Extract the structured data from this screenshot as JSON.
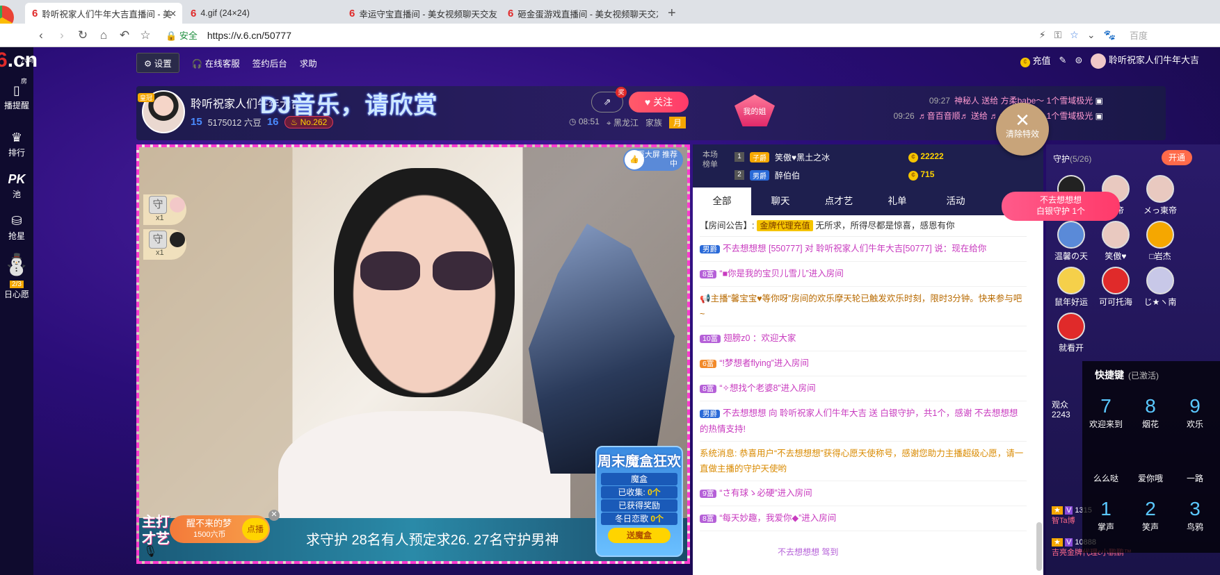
{
  "browser": {
    "tabs": [
      {
        "label": "聆听祝家人们牛年大吉直播间 - 美",
        "active": true
      },
      {
        "label": "4.gif (24×24)",
        "active": false
      },
      {
        "label": "幸运守宝直播间 - 美女视频聊天交友",
        "active": false
      },
      {
        "label": "砸金蛋游戏直播间 - 美女视频聊天交友",
        "active": false
      }
    ],
    "secure": "安全",
    "url": "https://v.6.cn/50777",
    "search_engine": "百度"
  },
  "site": {
    "logo": "6.cn",
    "logo_sub": "六间房",
    "left_nav": [
      "播提醒",
      "排行",
      "池",
      "抢星",
      "日心愿"
    ],
    "pk": "PK",
    "wish_count": "2/3",
    "menu": {
      "settings": "设置",
      "service": "在线客服",
      "checkin": "签约后台",
      "help": "求助"
    },
    "top_right": {
      "recharge": "充值",
      "user": "聆听祝家人们牛年大吉"
    }
  },
  "host": {
    "vip": "皇冠",
    "name": "聆听祝家人们牛年大吉",
    "banner": "DJ音乐，请欣赏",
    "level": "15",
    "beans": "5175012 六豆",
    "wealth": "16",
    "rank": "No.262",
    "follow": "关注",
    "share_tag": "奖",
    "time": "08:51",
    "location": "黑龙江",
    "family": "家族",
    "family_badge": "月",
    "my_dear": "我的姐"
  },
  "gift_feed": [
    {
      "time": "09:27",
      "text": "神秘人 送给 方柔babe～ 1个雪域极光"
    },
    {
      "time": "09:26",
      "text": "♬音百音顺♬ 送给 ♬♪百音百顺♬ 1个雪域极光"
    }
  ],
  "clear_fx": "清除特效",
  "video": {
    "featured": "首页大屏 推荐中",
    "guard_counts": [
      "x1",
      "x1"
    ],
    "main_play": "主打 才艺",
    "wake": {
      "title": "醒不来的梦",
      "price": "1500六币",
      "btn": "点播"
    },
    "marquee": "求守护  28名有人预定求26. 27名守护男神",
    "box": {
      "title": "周末魔盒狂欢",
      "sub": "魔盒",
      "collected_label": "已收集:",
      "collected": "0个",
      "reward": "已获得奖励",
      "winter": "冬日恋歌",
      "winter_count": "0个",
      "btn": "送魔盒"
    }
  },
  "rankboard": {
    "label": "本场 榜单",
    "rows": [
      {
        "n": "1",
        "badge": "子爵",
        "name": "笑傲♥黑土之冰",
        "amt": "22222"
      },
      {
        "n": "2",
        "badge": "男爵",
        "name": "醉伯伯",
        "amt": "715"
      }
    ]
  },
  "chat_tabs": [
    "全部",
    "聊天",
    "点才艺",
    "礼单",
    "活动"
  ],
  "announcement": {
    "label": "【房间公告】:",
    "tag": "金牌代理充值",
    "text": "无所求，所得尽都是惊喜，感恩有你"
  },
  "messages": [
    {
      "badge": "男爵",
      "text": "不去想想想 [550777] 对 聆听祝家人们牛年大吉[50777] 说：现在给你"
    },
    {
      "badge": "8富",
      "text": "“■你是我的宝贝儿雪儿”进入房间"
    },
    {
      "badge": "",
      "text": "主播“馨宝宝♥等你呀”房间的欢乐摩天轮已触发欢乐时刻，限时3分钟。快来参与吧~"
    },
    {
      "badge": "10富",
      "text": "翅膀z0 ：欢迎大家"
    },
    {
      "badge": "6富",
      "text": "“!梦想者flying”进入房间"
    },
    {
      "badge": "8富",
      "text": "“✧想找个老婆8”进入房间"
    },
    {
      "badge": "男爵",
      "text": "不去想想想 向 聆听祝家人们牛年大吉 送 白银守护，共1个，感谢 不去想想想 的热情支持!"
    },
    {
      "badge": "",
      "text": "系统消息: 恭喜用户“不去想想想”获得心愿天使称号，感谢您助力主播超级心愿，请一直做主播的守护天使哟"
    },
    {
      "badge": "9富",
      "text": "“さ有球ゝ必硬”进入房间"
    },
    {
      "badge": "8富",
      "text": "“每天妙趣，我爱你◆”进入房间"
    }
  ],
  "new_watch": "不去想想想 驾到",
  "guard": {
    "title": "守护",
    "count": "(5/26)",
    "open": "开通",
    "members": [
      "…",
      "…帝",
      "メっ東帝",
      "温馨の天",
      "笑傲♥",
      "□岩杰",
      "鼠年好运",
      "可可托海",
      "じ★ヽ南",
      "就看开"
    ]
  },
  "chat_hint": {
    "name": "不去想想想",
    "text": "白银守护 1个"
  },
  "audience": {
    "label": "观众",
    "count": "2243"
  },
  "shortcut": {
    "title": "快捷键",
    "status": "(已激活)",
    "keys": [
      {
        "k": "7",
        "label": "欢迎来到"
      },
      {
        "k": "8",
        "label": "烟花"
      },
      {
        "k": "9",
        "label": "欢乐"
      },
      {
        "k": "",
        "label": "么么哒"
      },
      {
        "k": "",
        "label": "爱你哦"
      },
      {
        "k": "",
        "label": "一路"
      },
      {
        "k": "1",
        "label": "掌声"
      },
      {
        "k": "2",
        "label": "笑声"
      },
      {
        "k": "3",
        "label": "鸟鸦"
      }
    ]
  },
  "right_users": [
    {
      "amt": "1315",
      "name": "智Ta博"
    },
    {
      "amt": "10888",
      "name": "吉亮金牌代理ϵ小鹏鹏™"
    }
  ]
}
